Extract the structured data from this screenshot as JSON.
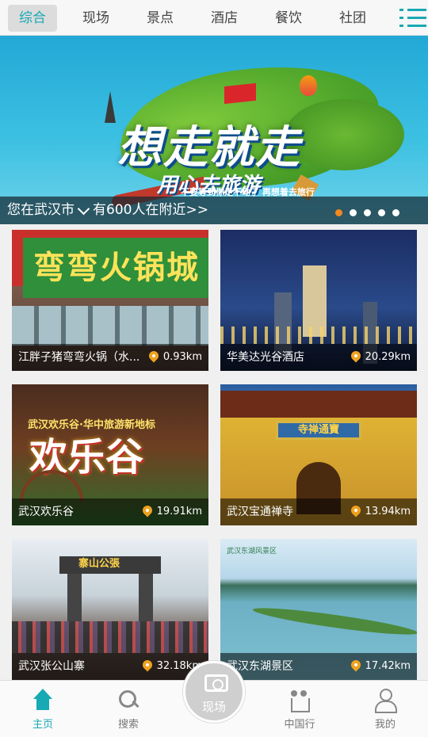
{
  "top_tabs": [
    {
      "label": "综合",
      "active": true
    },
    {
      "label": "现场"
    },
    {
      "label": "景点"
    },
    {
      "label": "酒店"
    },
    {
      "label": "餐饮"
    },
    {
      "label": "社团"
    }
  ],
  "menu_icon": "list-menu-icon",
  "accent_color": "#17a9b4",
  "banner": {
    "title": "想走就走",
    "subtitle": "用心去旅游",
    "tagline": "不要等到你走不动了 再想着去旅行",
    "location_prefix": "您在武汉市",
    "nearby_text": "有600人在附近>>",
    "slide_count": 5,
    "active_slide": 1
  },
  "cards": [
    {
      "name": "江胖子猪弯弯火锅（水...",
      "distance": "0.93km",
      "sign_text": "弯弯火锅城"
    },
    {
      "name": "华美达光谷酒店",
      "distance": "20.29km"
    },
    {
      "name": "武汉欢乐谷",
      "distance": "19.91km",
      "sign_line1": "武汉欢乐谷·华中旅游新地标",
      "sign_line2": "欢乐谷"
    },
    {
      "name": "武汉宝通禅寺",
      "distance": "13.94km",
      "plaque": "寺禅通寶"
    },
    {
      "name": "武汉张公山寨",
      "distance": "32.18km",
      "gate_text": "寨山公張"
    },
    {
      "name": "武汉东湖景区",
      "distance": "17.42km",
      "logo": "武汉东湖风景区"
    }
  ],
  "bottom_nav": [
    {
      "label": "主页",
      "icon": "home-icon",
      "active": true
    },
    {
      "label": "搜索",
      "icon": "search-icon"
    },
    {
      "label": "现场",
      "icon": "camera-icon"
    },
    {
      "label": "中国行",
      "icon": "hikers-icon"
    },
    {
      "label": "我的",
      "icon": "person-icon"
    }
  ]
}
